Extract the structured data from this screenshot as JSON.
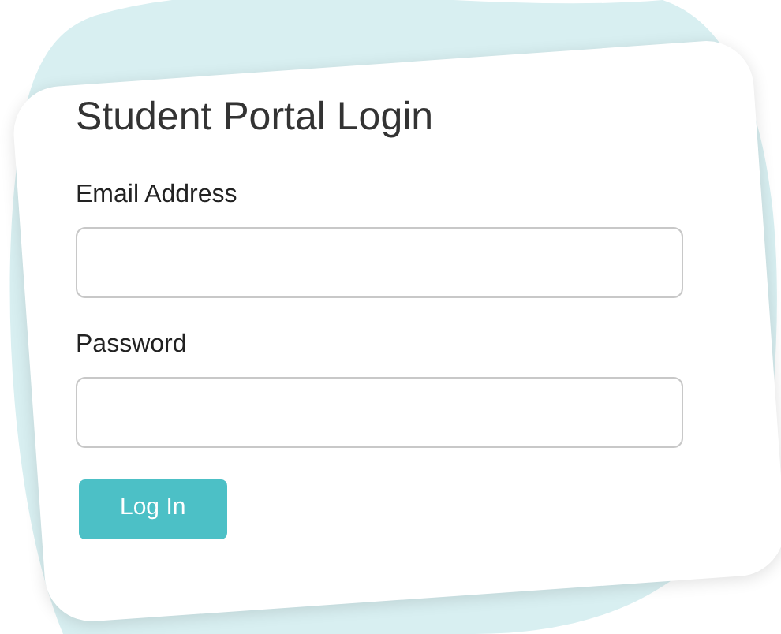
{
  "login_card": {
    "title": "Student Portal Login",
    "fields": [
      {
        "label": "Email Address"
      },
      {
        "label": "Password"
      }
    ],
    "button": "Log In"
  }
}
